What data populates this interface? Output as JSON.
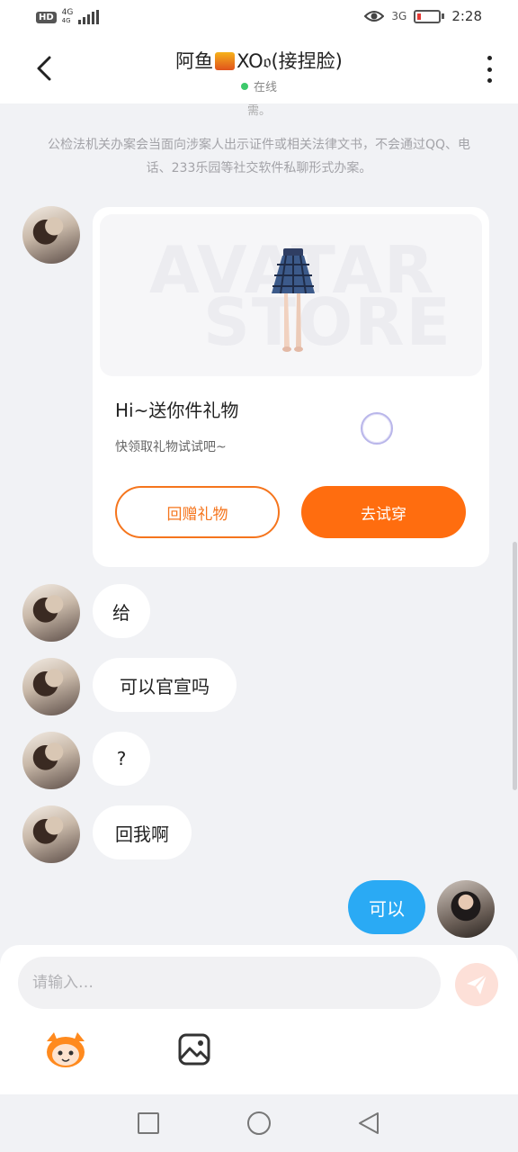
{
  "status_bar": {
    "hd": "HD",
    "network": "4G",
    "network_sub": "4G",
    "signal": "3G",
    "time": "2:28"
  },
  "header": {
    "title_prefix": "阿鱼",
    "title_suffix": "XO𝔬(接捏脸)",
    "status": "在线"
  },
  "notice": {
    "cut_text": "需。",
    "text": "公检法机关办案会当面向涉案人出示证件或相关法律文书，不会通过QQ、电话、233乐园等社交软件私聊形式办案。"
  },
  "gift_card": {
    "watermark_line1": "AVATAR",
    "watermark_line2": "STORE",
    "title": "Hi~送你件礼物",
    "subtitle": "快领取礼物试试吧~",
    "return_label": "回赠礼物",
    "try_label": "去试穿"
  },
  "messages": [
    {
      "from": "other",
      "text": "给"
    },
    {
      "from": "other",
      "text": "可以官宣吗"
    },
    {
      "from": "other",
      "text": "?"
    },
    {
      "from": "other",
      "text": "回我啊"
    },
    {
      "from": "me",
      "text": "可以"
    }
  ],
  "input": {
    "placeholder": "请输入…"
  },
  "colors": {
    "accent": "#ff6d0f",
    "my_bubble": "#2aaaf4",
    "online": "#3dc96b"
  },
  "icons": [
    "back-arrow-icon",
    "more-vert-icon",
    "send-icon",
    "mascot-icon",
    "image-icon",
    "nav-recents-icon",
    "nav-home-icon",
    "nav-back-icon"
  ]
}
